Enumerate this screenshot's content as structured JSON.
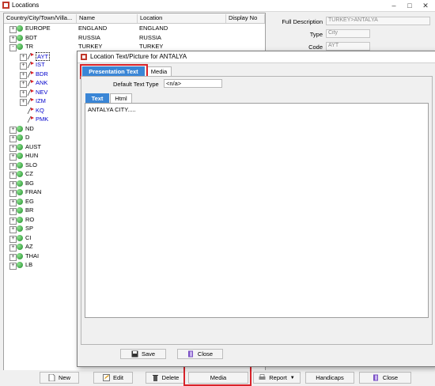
{
  "window": {
    "title": "Locations"
  },
  "columns": [
    "Country/City/Town/Villa...",
    "Name",
    "Location",
    "Display No"
  ],
  "tree_rows": [
    {
      "code": "EUROPE",
      "name": "ENGLAND",
      "location": "ENGLAND",
      "level": 0,
      "icon": "globe",
      "expander": "+"
    },
    {
      "code": "BDT",
      "name": "RUSSIA",
      "location": "RUSSIA",
      "level": 0,
      "icon": "globe",
      "expander": "+"
    },
    {
      "code": "TR",
      "name": "TURKEY",
      "location": "TURKEY",
      "level": 0,
      "icon": "globe",
      "expander": "-"
    },
    {
      "code": "AYT",
      "level": 1,
      "icon": "flag",
      "expander": "+",
      "blue": true,
      "selected": true
    },
    {
      "code": "IST",
      "level": 1,
      "icon": "flag",
      "expander": "+",
      "blue": true
    },
    {
      "code": "BDR",
      "level": 1,
      "icon": "flag",
      "expander": "+",
      "blue": true
    },
    {
      "code": "ANK",
      "level": 1,
      "icon": "flag",
      "expander": "+",
      "blue": true
    },
    {
      "code": "NEV",
      "level": 1,
      "icon": "flag",
      "expander": "+",
      "blue": true
    },
    {
      "code": "IZM",
      "level": 1,
      "icon": "flag",
      "expander": "+",
      "blue": true
    },
    {
      "code": "KQ",
      "level": 1,
      "icon": "flag",
      "expander": "",
      "blue": true
    },
    {
      "code": "PMK",
      "level": 1,
      "icon": "flag",
      "expander": "",
      "blue": true
    },
    {
      "code": "ND",
      "level": 0,
      "icon": "globe",
      "expander": "+"
    },
    {
      "code": "D",
      "level": 0,
      "icon": "globe",
      "expander": "+"
    },
    {
      "code": "AUST",
      "level": 0,
      "icon": "globe",
      "expander": "+"
    },
    {
      "code": "HUN",
      "level": 0,
      "icon": "globe",
      "expander": "+"
    },
    {
      "code": "SLO",
      "level": 0,
      "icon": "globe",
      "expander": "+"
    },
    {
      "code": "CZ",
      "level": 0,
      "icon": "globe",
      "expander": "+"
    },
    {
      "code": "BG",
      "level": 0,
      "icon": "globe",
      "expander": "+"
    },
    {
      "code": "FRAN",
      "level": 0,
      "icon": "globe",
      "expander": "+"
    },
    {
      "code": "EG",
      "level": 0,
      "icon": "globe",
      "expander": "+"
    },
    {
      "code": "BR",
      "level": 0,
      "icon": "globe",
      "expander": "+"
    },
    {
      "code": "RO",
      "level": 0,
      "icon": "globe",
      "expander": "+"
    },
    {
      "code": "SP",
      "level": 0,
      "icon": "globe",
      "expander": "+"
    },
    {
      "code": "CI",
      "level": 0,
      "icon": "globe",
      "expander": "+"
    },
    {
      "code": "AZ",
      "level": 0,
      "icon": "globe",
      "expander": "+"
    },
    {
      "code": "THAI",
      "level": 0,
      "icon": "globe",
      "expander": "+"
    },
    {
      "code": "LB",
      "level": 0,
      "icon": "globe",
      "expander": "+"
    }
  ],
  "detail": {
    "full_description_label": "Full Description",
    "full_description_value": "TURKEY>ANTALYA",
    "type_label": "Type",
    "type_value": "City",
    "code_label": "Code",
    "code_value": "AYT"
  },
  "dialog": {
    "title": "Location Text/Picture for ANTALYA",
    "tabs": [
      "Presentation Text",
      "Media"
    ],
    "default_text_type_label": "Default Text Type",
    "default_text_type_value": "<n/a>",
    "editor_tabs": [
      "Text",
      "Html"
    ],
    "editor_content": "ANTALYA CITY.....",
    "save_label": "Save",
    "close_label": "Close"
  },
  "bottom_buttons": [
    "New",
    "Edit",
    "Delete",
    "Media",
    "Report",
    "Handicaps",
    "Close"
  ],
  "colors": {
    "highlight": "#d9232a",
    "active_tab": "#3a86d6",
    "link_blue": "#0000cc"
  }
}
